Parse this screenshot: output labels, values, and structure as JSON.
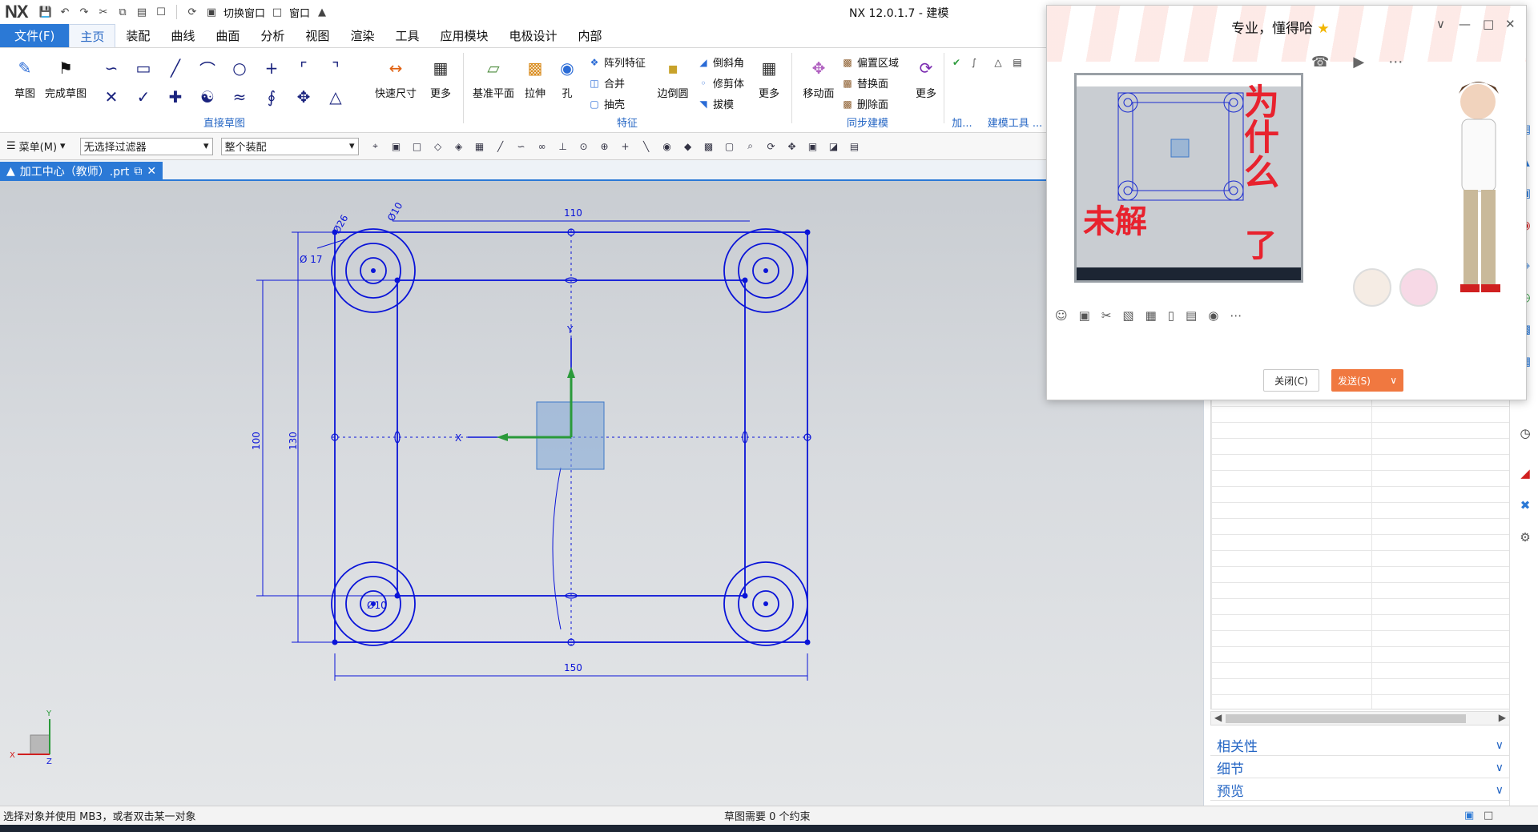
{
  "app": {
    "logo": "NX",
    "window_title": "NX 12.0.1.7 - 建模",
    "qat": {
      "switch_window": "切换窗口",
      "window": "窗口"
    }
  },
  "tabs": [
    {
      "label": "文件(F)"
    },
    {
      "label": "主页"
    },
    {
      "label": "装配"
    },
    {
      "label": "曲线"
    },
    {
      "label": "曲面"
    },
    {
      "label": "分析"
    },
    {
      "label": "视图"
    },
    {
      "label": "渲染"
    },
    {
      "label": "工具"
    },
    {
      "label": "应用模块"
    },
    {
      "label": "电极设计"
    },
    {
      "label": "内部"
    }
  ],
  "ribbon": {
    "sketch": "草图",
    "finish_sketch": "完成草图",
    "direct_sketch": "直接草图",
    "rapid_dim": "快速尺寸",
    "more": "更多",
    "datum_plane": "基准平面",
    "extrude": "拉伸",
    "hole": "孔",
    "pattern_feature": "阵列特征",
    "unite": "合并",
    "shell": "抽壳",
    "edge_blend": "边倒圆",
    "chamfer": "倒斜角",
    "trim_body": "修剪体",
    "draft": "拔模",
    "feature": "特征",
    "move_face": "移动面",
    "offset_region": "偏置区域",
    "replace_face": "替换面",
    "delete_face": "删除面",
    "sync_modeling": "同步建模",
    "add": "加...",
    "modeling_tools": "建模工具 ..."
  },
  "cmdbar": {
    "menu": "菜单(M)",
    "filter": "无选择过滤器",
    "assembly": "整个装配"
  },
  "doc_tab": {
    "label": "加工中心（教师）.prt"
  },
  "sketch": {
    "dims": {
      "d110": "110",
      "d150": "150",
      "d100": "100",
      "d130": "130",
      "phi17": "Ø 17",
      "phi26": "Ø26",
      "phi10": "Ø10",
      "phi10b": "Ø10"
    },
    "axis_x": "X",
    "axis_y": "Y",
    "axis_z": "Z"
  },
  "right_panel": {
    "sections": [
      {
        "label": "相关性"
      },
      {
        "label": "细节"
      },
      {
        "label": "预览"
      }
    ]
  },
  "status": {
    "left": "选择对象并使用 MB3，或者双击某一对象",
    "center": "草图需要 0 个约束"
  },
  "chat": {
    "contact": "专业，懂得哈",
    "star": "★",
    "close": "关闭(C)",
    "send": "发送(S)",
    "handwriting_1": "为什么",
    "handwriting_2": "未解",
    "handwriting_3": "了"
  },
  "colors": {
    "accent": "#2b79d6",
    "sketch_blue": "#0a14d8",
    "send": "#f07840",
    "handwriting": "#e8222e"
  }
}
